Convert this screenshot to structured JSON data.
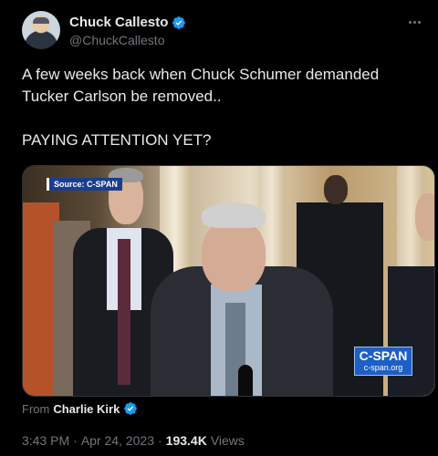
{
  "author": {
    "display_name": "Chuck Callesto",
    "handle": "@ChuckCallesto"
  },
  "tweet": {
    "text": "A few weeks back when Chuck Schumer demanded Tucker Carlson be removed..\n\nPAYING ATTENTION YET?"
  },
  "media": {
    "source_label": "Source: C-SPAN",
    "watermark_title": "C-SPAN",
    "watermark_url": "c-span.org"
  },
  "attribution": {
    "from_label": "From",
    "from_name": "Charlie Kirk"
  },
  "meta": {
    "time": "3:43 PM",
    "separator": "·",
    "date": "Apr 24, 2023",
    "views_count": "193.4K",
    "views_label": "Views"
  },
  "colors": {
    "verified_badge": "#1d9bf0",
    "background": "#000000",
    "secondary_text": "#71767b"
  },
  "icons": {
    "verified": "verified-badge-icon",
    "more": "more-options-icon"
  }
}
